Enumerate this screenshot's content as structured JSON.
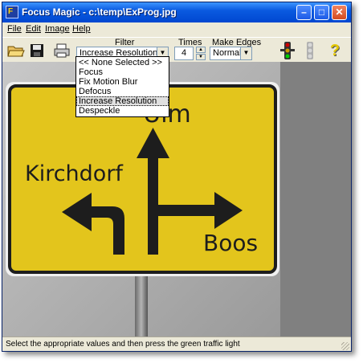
{
  "window": {
    "title": "Focus Magic - c:\\temp\\ExProg.jpg",
    "app_icon_glyph": "F",
    "min_glyph": "–",
    "max_glyph": "□",
    "close_glyph": "✕"
  },
  "menu": {
    "file": "File",
    "edit": "Edit",
    "image": "Image",
    "help": "Help"
  },
  "toolbar": {
    "icons": [
      "open-folder-icon",
      "save-disk-icon",
      "print-icon",
      "traffic-light-green-icon",
      "traffic-light-disabled-icon",
      "help-question-icon"
    ],
    "filter_label": "Filter",
    "filter_value": "Increase Resolution",
    "times_label": "Times",
    "times_value": "4",
    "make_edges_label": "Make Edges",
    "make_edges_value": "Normal",
    "help_glyph": "?"
  },
  "filter_options": [
    "<< None Selected >>",
    "Focus",
    "Fix Motion Blur",
    "Defocus",
    "Increase Resolution",
    "Despeckle"
  ],
  "filter_selected_index": 4,
  "sign": {
    "left_text": "Kirchdorf",
    "top_text": "Ulm",
    "right_text": "Boos",
    "color": "#e3c51c"
  },
  "status": {
    "text": "Select the appropriate values and then press the green traffic light"
  }
}
